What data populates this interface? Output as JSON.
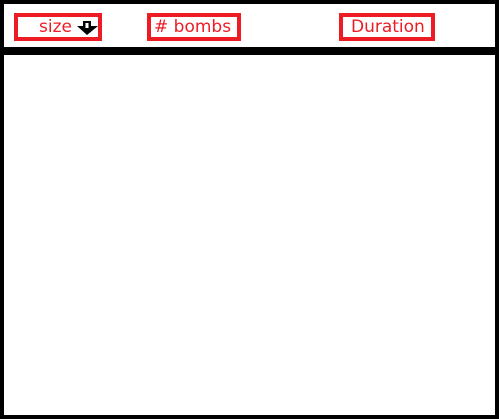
{
  "header": {
    "columns": [
      {
        "label": "size",
        "sort_icon": "sort-down-arrow-icon"
      },
      {
        "label": "# bombs"
      },
      {
        "label": "Duration"
      }
    ]
  },
  "colors": {
    "border": "#000000",
    "column_accent": "#ed1c24"
  }
}
